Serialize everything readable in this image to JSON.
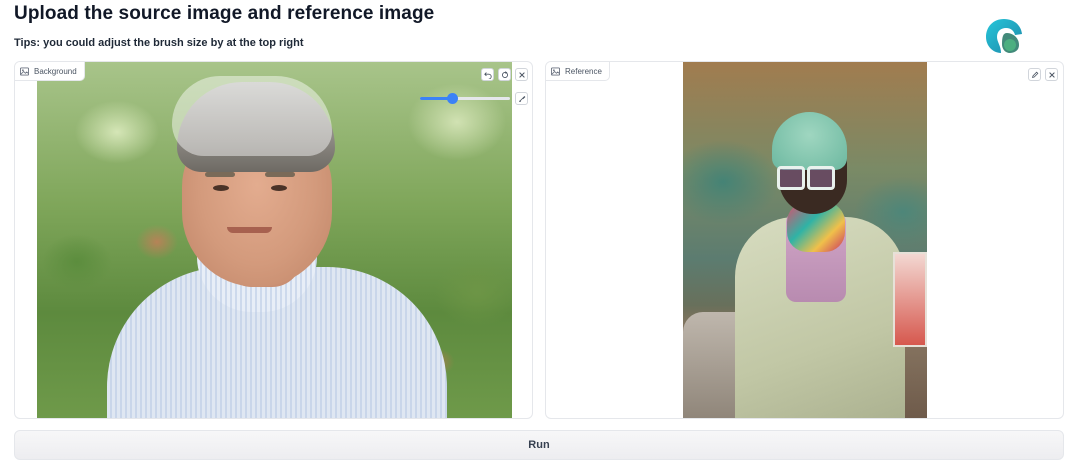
{
  "page": {
    "title": "Upload the source image and reference image",
    "tips": "Tips: you could adjust the brush size by at the top right"
  },
  "background_panel": {
    "label": "Background",
    "tools": [
      "undo-icon",
      "reset-icon",
      "close-icon",
      "brush-color-icon"
    ],
    "brush_size": {
      "value": 0.35
    }
  },
  "reference_panel": {
    "label": "Reference",
    "tools": [
      "edit-icon",
      "close-icon"
    ]
  },
  "run_button": {
    "label": "Run"
  },
  "colors": {
    "accent": "#3b82f6",
    "border": "#e5e7eb",
    "button_bg": "#f1f1f3"
  }
}
